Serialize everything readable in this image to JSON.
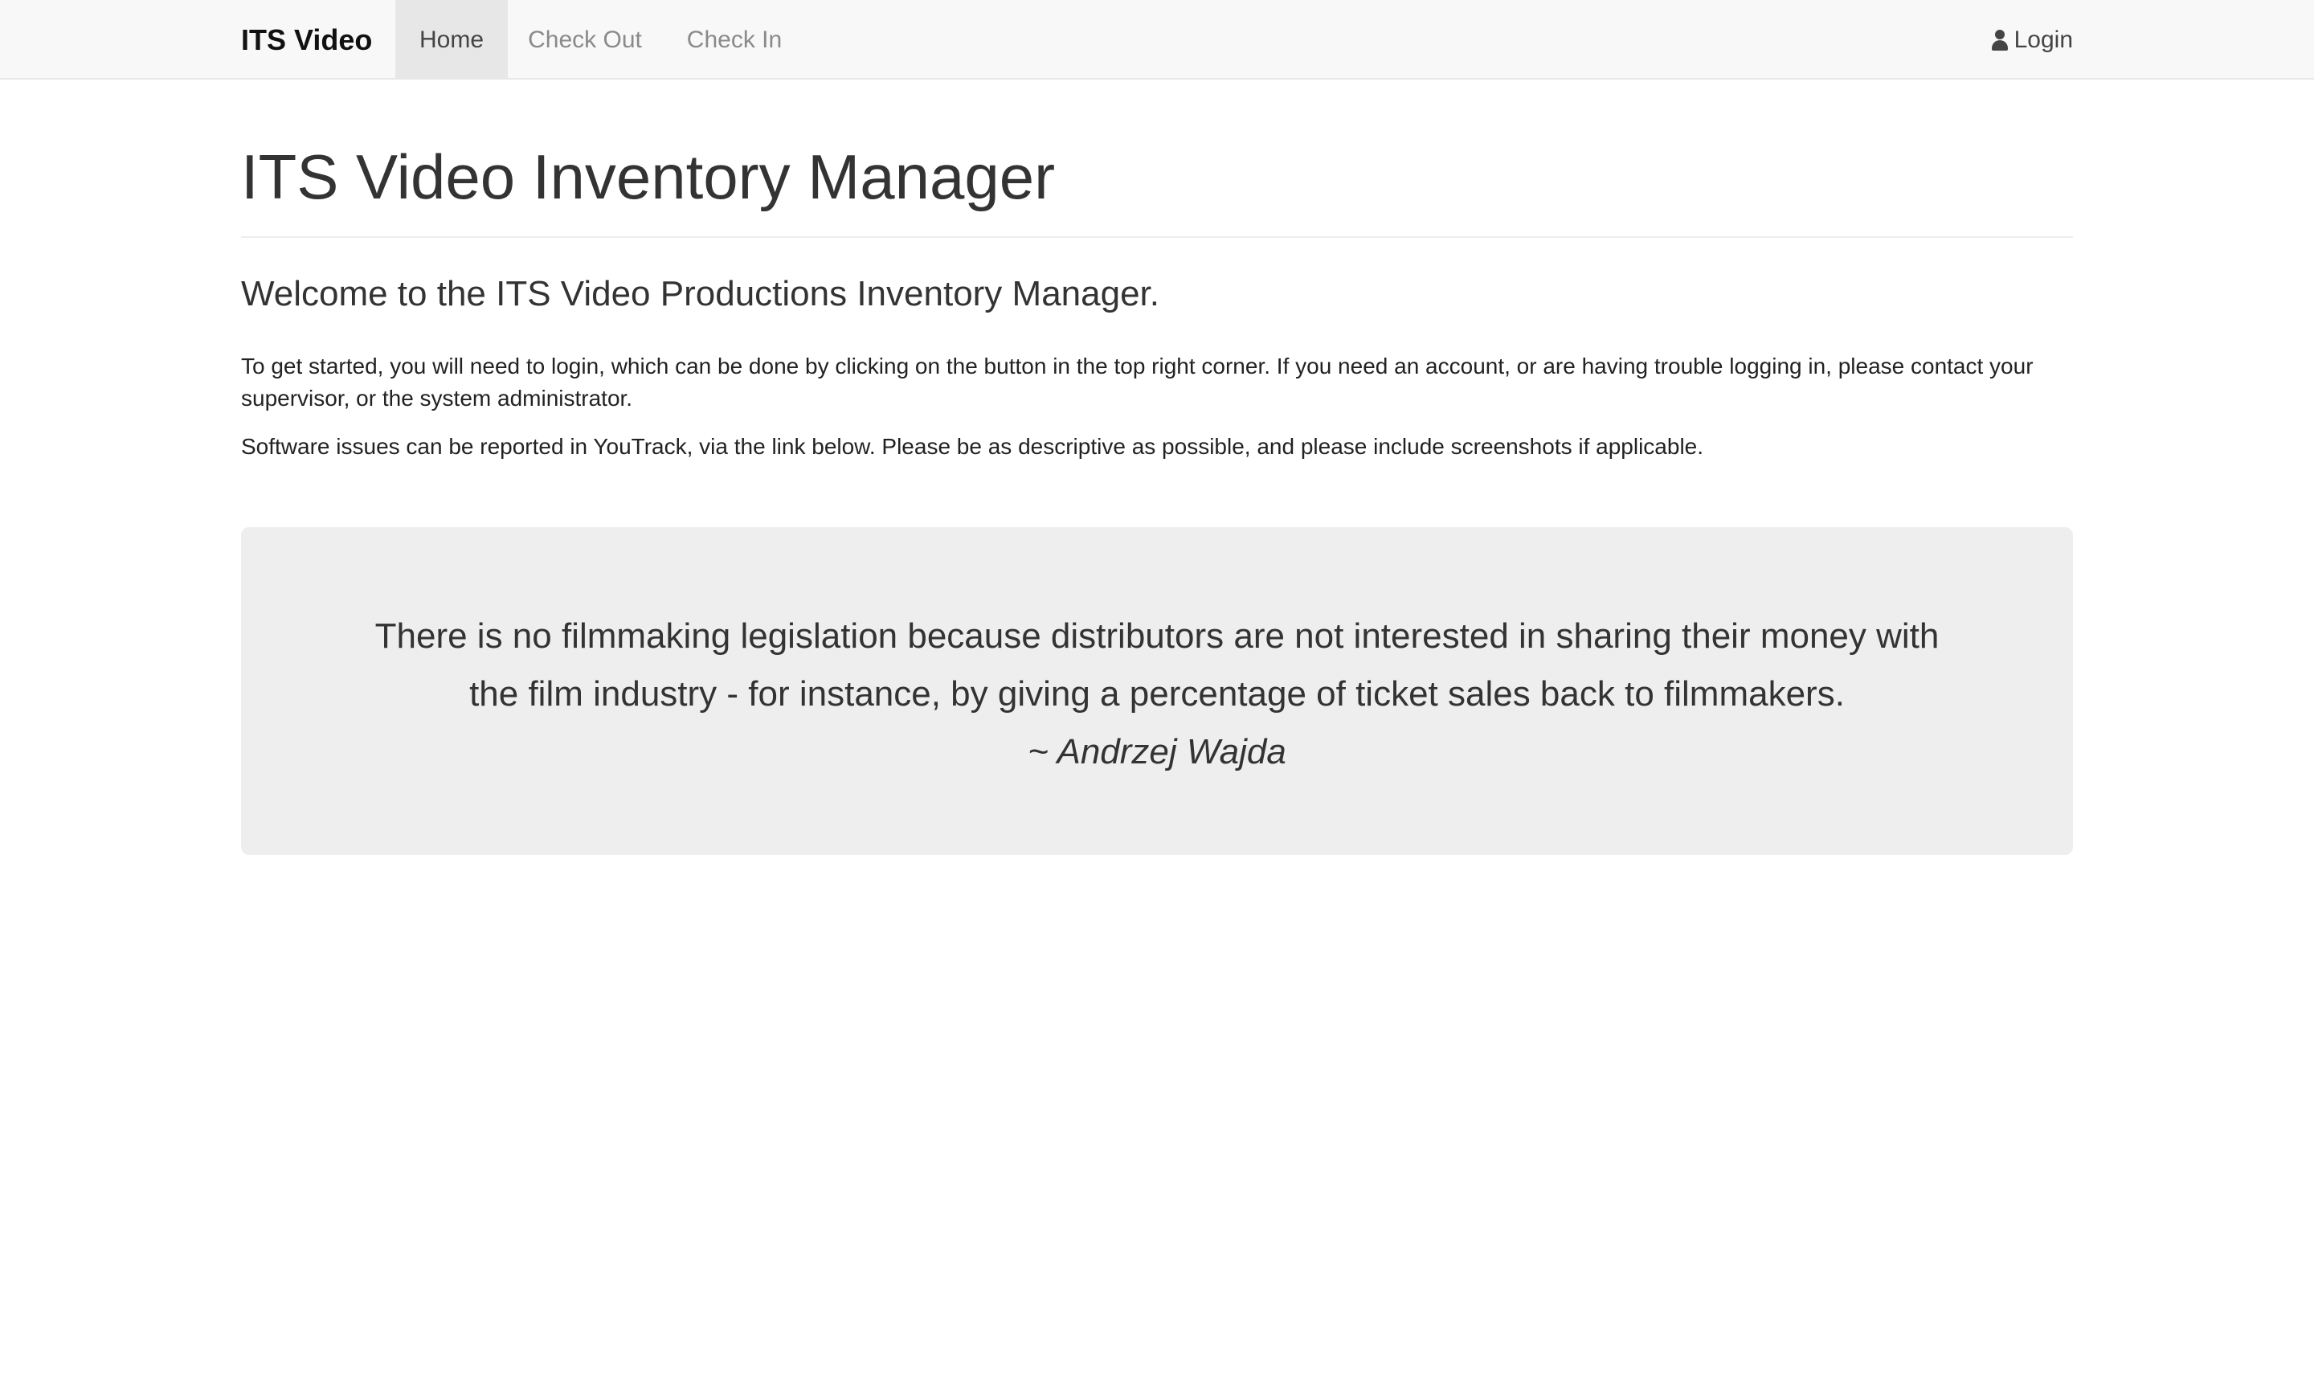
{
  "navbar": {
    "brand": "ITS Video",
    "items": [
      {
        "label": "Home",
        "active": true
      },
      {
        "label": "Check Out",
        "active": false
      },
      {
        "label": "Check In",
        "active": false
      }
    ],
    "login_label": "Login",
    "login_icon": "user-icon"
  },
  "main": {
    "title": "ITS Video Inventory Manager",
    "welcome": "Welcome to the ITS Video Productions Inventory Manager.",
    "paragraphs": [
      "To get started, you will need to login, which can be done by clicking on the button in the top right corner. If you need an account, or are having trouble logging in, please contact your supervisor, or the system administrator.",
      "Software issues can be reported in YouTrack, via the link below. Please be as descriptive as possible, and please include screenshots if applicable."
    ]
  },
  "quote": {
    "text": "There is no filmmaking legislation because distributors are not interested in sharing their money with the film industry - for instance, by giving a percentage of ticket sales back to filmmakers.",
    "author": "~ Andrzej Wajda"
  },
  "colors": {
    "navbar_bg": "#f8f8f8",
    "active_tab_bg": "#e7e7e7",
    "quote_bg": "#eeeeee"
  }
}
